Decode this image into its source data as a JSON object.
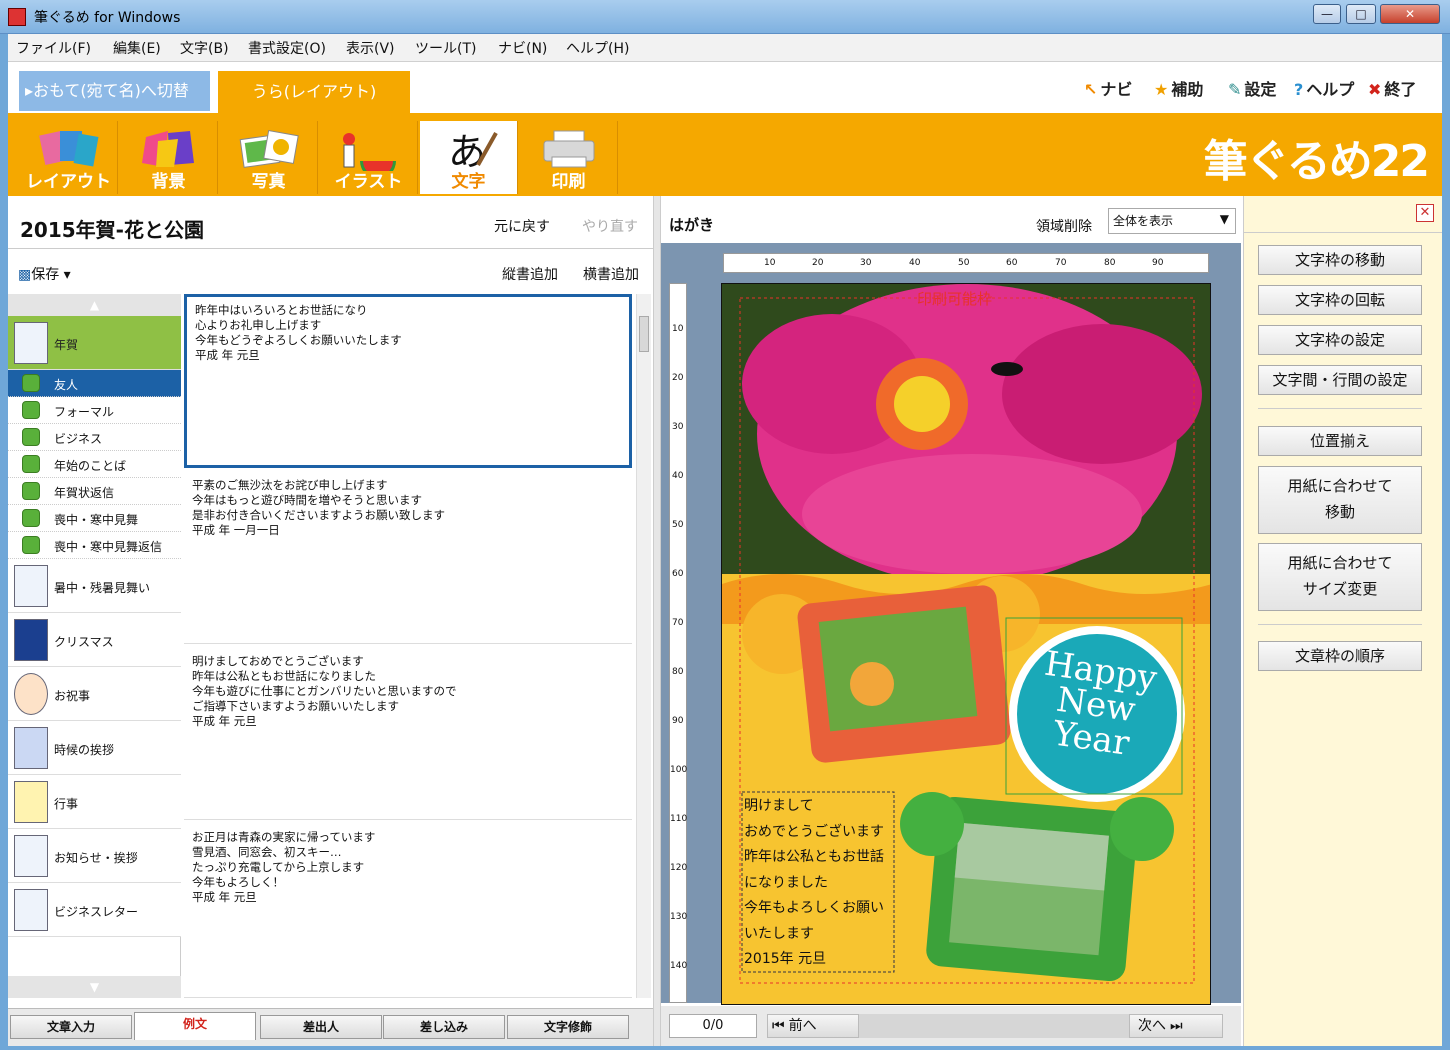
{
  "window": {
    "title": "筆ぐるめ for Windows"
  },
  "menu": [
    "ファイル(F)",
    "編集(E)",
    "文字(B)",
    "書式設定(O)",
    "表示(V)",
    "ツール(T)",
    "ナビ(N)",
    "ヘルプ(H)"
  ],
  "top": {
    "switch_label": "▸おもて(宛て名)へ切替",
    "tab_label": "うら(レイアウト)",
    "links": [
      {
        "icon": "navi-icon",
        "label": "ナビ"
      },
      {
        "icon": "star-icon",
        "label": "補助"
      },
      {
        "icon": "wrench-icon",
        "label": "設定"
      },
      {
        "icon": "help-icon",
        "label": "ヘルプ"
      },
      {
        "icon": "exit-icon",
        "label": "終了"
      }
    ]
  },
  "toolbar": {
    "tools": [
      "レイアウト",
      "背景",
      "写真",
      "イラスト",
      "文字",
      "印刷"
    ],
    "active": "文字",
    "logo": "筆ぐるめ22"
  },
  "left": {
    "doc_title": "2015年賀-花と公園",
    "undo": "元に戻す",
    "redo": "やり直す",
    "save": "保存",
    "add_vertical": "縦書追加",
    "add_horizontal": "横書追加",
    "categories": [
      {
        "label": "年賀",
        "selected": true
      },
      {
        "label": "暑中・残暑見舞い"
      },
      {
        "label": "クリスマス"
      },
      {
        "label": "お祝事"
      },
      {
        "label": "時候の挨拶"
      },
      {
        "label": "行事"
      },
      {
        "label": "お知らせ・挨拶"
      },
      {
        "label": "ビジネスレター"
      }
    ],
    "subcategories": [
      {
        "label": "友人",
        "selected": true
      },
      {
        "label": "フォーマル"
      },
      {
        "label": "ビジネス"
      },
      {
        "label": "年始のことば"
      },
      {
        "label": "年賀状返信"
      },
      {
        "label": "喪中・寒中見舞"
      },
      {
        "label": "喪中・寒中見舞返信"
      }
    ],
    "examples": [
      "昨年中はいろいろとお世話になり\n心よりお礼申し上げます\n今年もどうぞよろしくお願いいたします\n 平成 年 元旦",
      "平素のご無沙汰をお詫び申し上げます\n今年はもっと遊び時間を増やそうと思います\n是非お付き合いくださいますようお願い致します\n 平成 年 一月一日",
      "明けましておめでとうございます\n昨年は公私ともお世話になりました\n今年も遊びに仕事にとガンバリたいと思いますので\nご指導下さいますようお願いいたします\n 平成 年 元旦",
      "お正月は青森の実家に帰っています\n雪見酒、同窓会、初スキー…\nたっぷり充電してから上京します\n今年もよろしく！\n 平成 年 元旦"
    ],
    "bottom_tabs": [
      "文章入力",
      "例文",
      "差出人",
      "差し込み",
      "文字修飾"
    ],
    "bottom_tab_selected": "例文"
  },
  "preview": {
    "label": "はがき",
    "region_delete": "領域削除",
    "view_select": "全体を表示",
    "ruler_h": [
      "10",
      "20",
      "30",
      "40",
      "50",
      "60",
      "70",
      "80",
      "90"
    ],
    "ruler_v": [
      "10",
      "20",
      "30",
      "40",
      "50",
      "60",
      "70",
      "80",
      "90",
      "100",
      "110",
      "120",
      "130",
      "140"
    ],
    "printable_label": "印刷可能枠",
    "card_text": [
      "明けまして",
      "おめでとうございます",
      "昨年は公私ともお世話",
      "になりました",
      "今年もよろしくお願い",
      "いたします",
      " 2015年 元旦"
    ],
    "happy_new_year": [
      "Happy",
      "New",
      "Year"
    ],
    "page_counter": "0/0",
    "prev": "前へ",
    "next": "次へ"
  },
  "right": {
    "buttons_group1": [
      "文字枠の移動",
      "文字枠の回転",
      "文字枠の設定",
      "文字間・行間の設定"
    ],
    "buttons_group2": [
      "位置揃え",
      "用紙に合わせて\n移動",
      "用紙に合わせて\nサイズ変更"
    ],
    "buttons_group3": [
      "文章枠の順序"
    ]
  },
  "colors": {
    "accent_orange": "#f5a800",
    "selected_blue": "#1c61a6",
    "selected_green": "#8fc045"
  }
}
